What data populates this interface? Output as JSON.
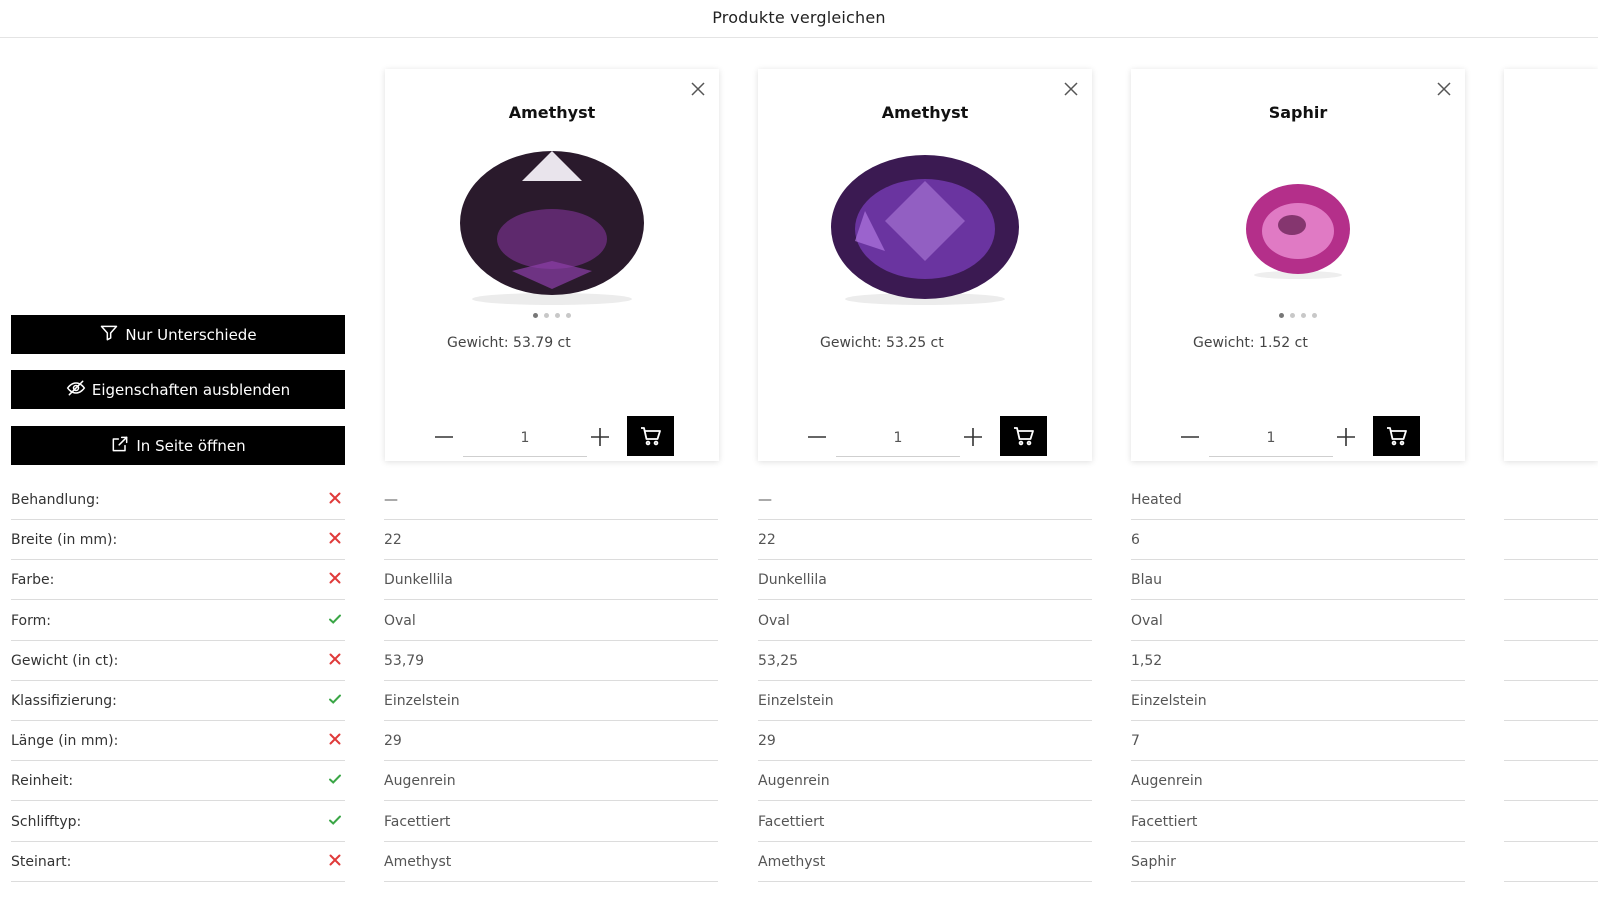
{
  "header": {
    "title": "Produkte vergleichen"
  },
  "actions": {
    "differences_label": "Nur Unterschiede",
    "hide_label": "Eigenschaften ausblenden",
    "open_label": "In Seite öffnen"
  },
  "colors": {
    "accent": "#000000",
    "match": "#3aa646",
    "mismatch": "#e03a3a"
  },
  "attributes": [
    {
      "label": "Behandlung:",
      "same": false,
      "icon": "cross-icon"
    },
    {
      "label": "Breite (in mm):",
      "same": false,
      "icon": "cross-icon"
    },
    {
      "label": "Farbe:",
      "same": false,
      "icon": "cross-icon"
    },
    {
      "label": "Form:",
      "same": true,
      "icon": "check-icon"
    },
    {
      "label": "Gewicht (in ct):",
      "same": false,
      "icon": "cross-icon"
    },
    {
      "label": "Klassifizierung:",
      "same": true,
      "icon": "check-icon"
    },
    {
      "label": "Länge (in mm):",
      "same": false,
      "icon": "cross-icon"
    },
    {
      "label": "Reinheit:",
      "same": true,
      "icon": "check-icon"
    },
    {
      "label": "Schlifftyp:",
      "same": true,
      "icon": "check-icon"
    },
    {
      "label": "Steinart:",
      "same": false,
      "icon": "cross-icon"
    }
  ],
  "products": [
    {
      "name": "Amethyst",
      "weight_label": "Gewicht:",
      "weight_value": "53.79 ct",
      "quantity": "1",
      "gem_color": "#3a1f3b",
      "values": [
        "—",
        "22",
        "Dunkellila",
        "Oval",
        "53,79",
        "Einzelstein",
        "29",
        "Augenrein",
        "Facettiert",
        "Amethyst"
      ]
    },
    {
      "name": "Amethyst",
      "weight_label": "Gewicht:",
      "weight_value": "53.25 ct",
      "quantity": "1",
      "gem_color": "#5b2a86",
      "values": [
        "—",
        "22",
        "Dunkellila",
        "Oval",
        "53,25",
        "Einzelstein",
        "29",
        "Augenrein",
        "Facettiert",
        "Amethyst"
      ]
    },
    {
      "name": "Saphir",
      "weight_label": "Gewicht:",
      "weight_value": "1.52 ct",
      "quantity": "1",
      "gem_color": "#c23a9a",
      "values": [
        "Heated",
        "6",
        "Blau",
        "Oval",
        "1,52",
        "Einzelstein",
        "7",
        "Augenrein",
        "Facettiert",
        "Saphir"
      ]
    }
  ]
}
